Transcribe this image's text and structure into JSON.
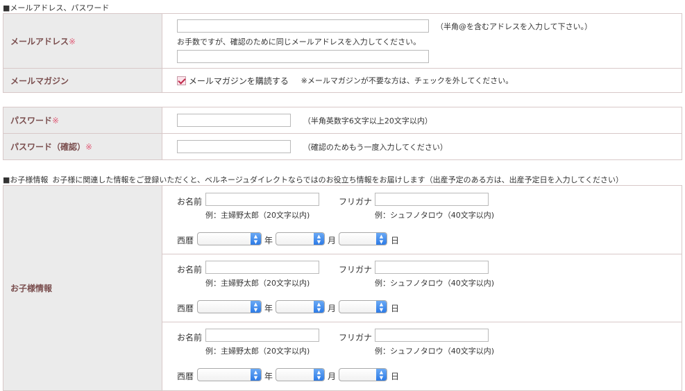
{
  "sections": {
    "email_password_title": "■メールアドレス、パスワード",
    "child_title": "■お子様情報",
    "child_desc": "お子様に関連した情報をご登録いただくと、ベルネージュダイレクトならではのお役立ち情報をお届けします（出産予定のある方は、出産予定日を入力してください）"
  },
  "email": {
    "label": "メールアドレス",
    "required_mark": "※",
    "hint": "（半角@を含むアドレスを入力して下さい。）",
    "confirm_note": "お手数ですが、確認のために同じメールアドレスを入力してください。"
  },
  "magazine": {
    "label": "メールマガジン",
    "checkbox_label": "メールマガジンを購読する",
    "checked": true,
    "note": "※メールマガジンが不要な方は、チェックを外してください。"
  },
  "password": {
    "label": "パスワード",
    "required_mark": "※",
    "hint": "（半角英数字6文字以上20文字以内）"
  },
  "password_confirm": {
    "label": "パスワード（確認）",
    "required_mark": "※",
    "hint": "（確認のためもう一度入力してください）"
  },
  "child": {
    "label": "お子様情報",
    "name_label": "お名前",
    "name_example": "例：主婦野太郎（20文字以内)",
    "kana_label": "フリガナ",
    "kana_example": "例：シュフノタロウ（40文字以内)",
    "era_label": "西暦",
    "year_unit": "年",
    "month_unit": "月",
    "day_unit": "日",
    "entries": [
      1,
      2,
      3
    ]
  },
  "colors": {
    "label_text": "#7a4e4e",
    "required": "#e0607a",
    "select_arrow": "#2d7be6"
  }
}
